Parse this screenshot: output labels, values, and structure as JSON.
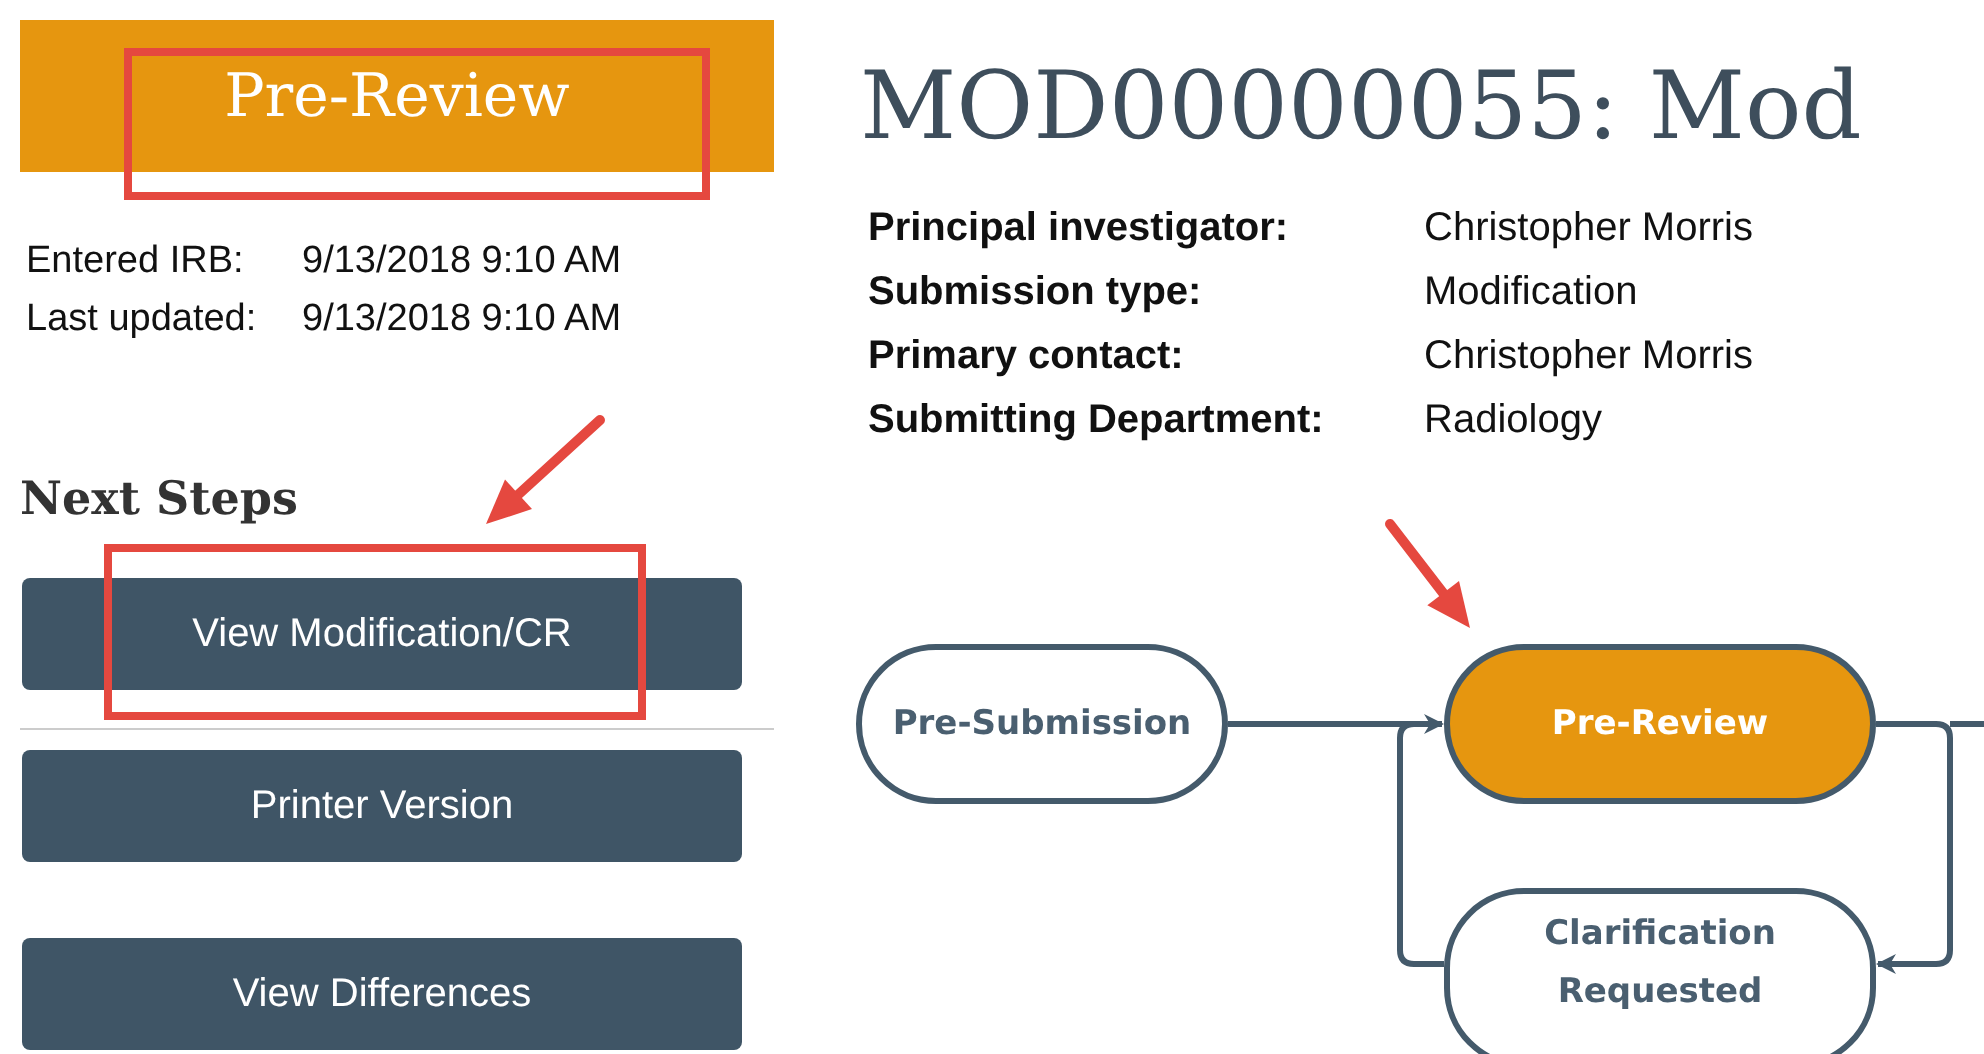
{
  "status_header": {
    "label": "Pre-Review"
  },
  "dates": [
    {
      "label": "Entered IRB:",
      "value": "9/13/2018 9:10 AM"
    },
    {
      "label": "Last updated:",
      "value": "9/13/2018 9:10 AM"
    }
  ],
  "next_steps": {
    "heading": "Next Steps",
    "buttons": [
      "View Modification/CR",
      "Printer Version",
      "View Differences"
    ]
  },
  "title": "MOD00000055: Mod",
  "details": [
    {
      "label": "Principal investigator:",
      "value": "Christopher Morris"
    },
    {
      "label": "Submission type:",
      "value": "Modification"
    },
    {
      "label": "Primary contact:",
      "value": "Christopher Morris"
    },
    {
      "label": "Submitting Department:",
      "value": "Radiology"
    }
  ],
  "workflow": {
    "states": [
      {
        "label": "Pre-Submission",
        "current": false
      },
      {
        "label": "Pre-Review",
        "current": true
      },
      {
        "label": "Clarification Requested",
        "current": false
      }
    ]
  }
}
